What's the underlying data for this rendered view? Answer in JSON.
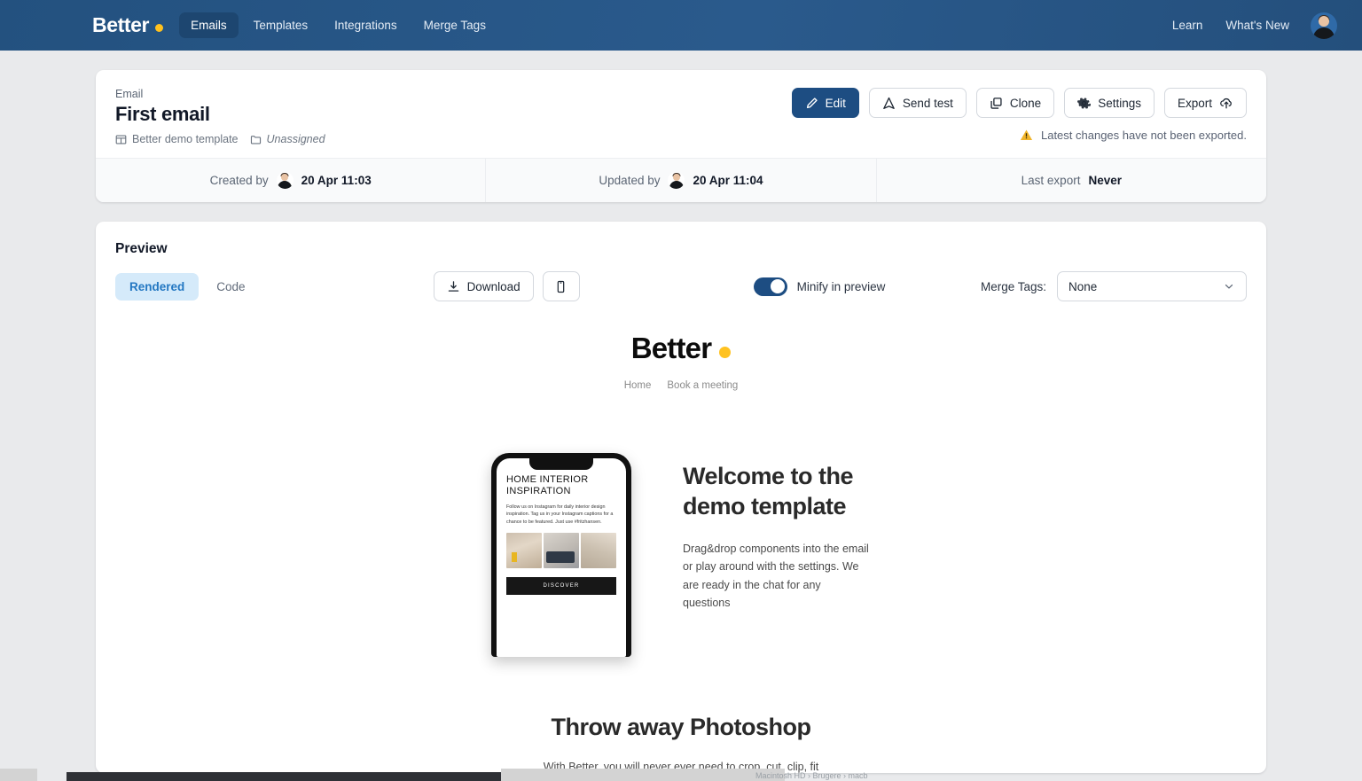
{
  "topnav": {
    "brand": "Better",
    "items": [
      {
        "label": "Emails",
        "active": true
      },
      {
        "label": "Templates",
        "active": false
      },
      {
        "label": "Integrations",
        "active": false
      },
      {
        "label": "Merge Tags",
        "active": false
      }
    ],
    "right": [
      {
        "label": "Learn"
      },
      {
        "label": "What's New"
      }
    ],
    "avatar_name": "user-avatar",
    "colors": {
      "bar": "#23517f",
      "active_pill": "#1d4670",
      "brand_dot": "#ffc11e"
    }
  },
  "header": {
    "kicker": "Email",
    "title": "First email",
    "template_label": "Better demo template",
    "folder_label": "Unassigned",
    "buttons": [
      {
        "label": "Edit",
        "icon": "pencil-icon",
        "primary": true
      },
      {
        "label": "Send test",
        "icon": "send-test-icon",
        "primary": false
      },
      {
        "label": "Clone",
        "icon": "copy-icon",
        "primary": false
      },
      {
        "label": "Settings",
        "icon": "gear-icon",
        "primary": false
      },
      {
        "label": "Export",
        "icon": "upload-cloud-icon",
        "primary": false
      }
    ],
    "warning": "Latest changes have not been exported.",
    "warning_color": "#f0b429",
    "meta": [
      {
        "label": "Created by",
        "has_avatar": true,
        "value": "20 Apr 11:03"
      },
      {
        "label": "Updated by",
        "has_avatar": true,
        "value": "20 Apr 11:04"
      },
      {
        "label": "Last export",
        "has_avatar": false,
        "value": "Never"
      }
    ]
  },
  "preview": {
    "title": "Preview",
    "tabs": [
      {
        "label": "Rendered",
        "active": true
      },
      {
        "label": "Code",
        "active": false
      }
    ],
    "download_label": "Download",
    "mobile_icon": "mobile-phone-icon",
    "toggle_label": "Minify in preview",
    "toggle_on": true,
    "merge_label": "Merge Tags:",
    "merge_value": "None",
    "merge_options": [
      "None"
    ]
  },
  "email": {
    "logo_text": "Better",
    "nav": [
      "Home",
      "Book a meeting"
    ],
    "phone": {
      "headline": "HOME INTERIOR INSPIRATION",
      "body": "Follow us on Instagram for daily interior design inspiration. Tag us in your Instagram captions for a chance to be featured. Just use #fritzhansen.",
      "cta": "DISCOVER"
    },
    "hero_heading": "Welcome to the demo template",
    "hero_body": "Drag&drop components into the email or play around with the settings. We are ready in the chat for any questions",
    "section2_heading": "Throw away Photoshop",
    "section2_body": "With Better, you will never ever need to crop, cut, clip, fit"
  },
  "desktop": {
    "finder_path": "Macintosh HD  ›  Brugere  ›  macb"
  }
}
